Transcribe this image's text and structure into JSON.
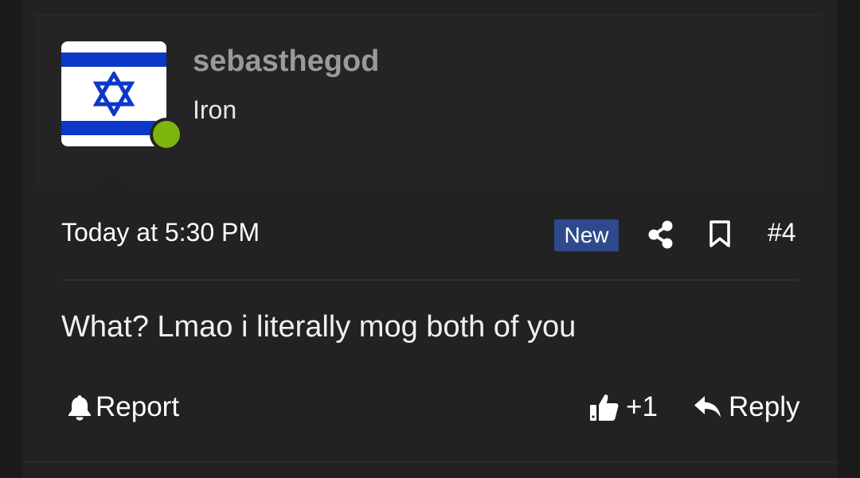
{
  "user": {
    "username": "sebasthegod",
    "title": "Iron",
    "avatar_icon": "israel-flag-icon",
    "online_status_color": "#7db40e"
  },
  "post": {
    "timestamp": "Today at 5:30 PM",
    "new_badge": "New",
    "number": "#4",
    "message": "What? Lmao i literally mog both of you"
  },
  "actions": {
    "report_label": "Report",
    "reaction_count": "+1",
    "reply_label": "Reply"
  },
  "icons": {
    "share": "share-icon",
    "bookmark": "bookmark-icon",
    "report": "bell-icon",
    "like": "thumbs-up-icon",
    "reply": "reply-arrow-icon"
  },
  "colors": {
    "background": "#222222",
    "badge": "#2e4a8c",
    "username": "#9a9a9a",
    "flag_blue": "#0b38c7"
  }
}
